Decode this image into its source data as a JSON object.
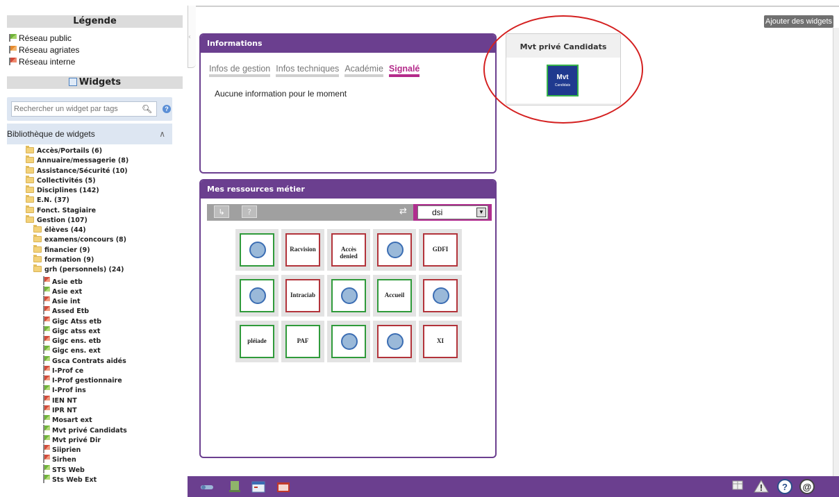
{
  "sidebar": {
    "legend_title": "Légende",
    "legend": [
      {
        "label": "Réseau public",
        "color": "green"
      },
      {
        "label": "Réseau agriates",
        "color": "orange"
      },
      {
        "label": "Réseau interne",
        "color": "red"
      }
    ],
    "widgets_title": "Widgets",
    "search_placeholder": "Rechercher un widget par tags",
    "library_title": "Bibliothèque de widgets",
    "tree": [
      {
        "label": "Accès/Portails (6)",
        "type": "folder",
        "level": 0
      },
      {
        "label": "Annuaire/messagerie (8)",
        "type": "folder",
        "level": 0
      },
      {
        "label": "Assistance/Sécurité (10)",
        "type": "folder",
        "level": 0
      },
      {
        "label": "Collectivités (5)",
        "type": "folder",
        "level": 0
      },
      {
        "label": "Disciplines (142)",
        "type": "folder",
        "level": 0
      },
      {
        "label": "E.N. (37)",
        "type": "folder",
        "level": 0
      },
      {
        "label": "Fonct. Stagiaire",
        "type": "folder",
        "level": 0
      },
      {
        "label": "Gestion (107)",
        "type": "folder",
        "level": 0
      },
      {
        "label": "élèves (44)",
        "type": "folder",
        "level": 1
      },
      {
        "label": "examens/concours (8)",
        "type": "folder",
        "level": 1
      },
      {
        "label": "financier (9)",
        "type": "folder",
        "level": 1
      },
      {
        "label": "formation (9)",
        "type": "folder",
        "level": 1
      },
      {
        "label": "grh (personnels) (24)",
        "type": "folder",
        "level": 1
      },
      {
        "label": "Asie etb",
        "type": "leaf",
        "flag": "red"
      },
      {
        "label": "Asie ext",
        "type": "leaf",
        "flag": "green"
      },
      {
        "label": "Asie int",
        "type": "leaf",
        "flag": "red"
      },
      {
        "label": "Assed Etb",
        "type": "leaf",
        "flag": "red"
      },
      {
        "label": "Gigc Atss etb",
        "type": "leaf",
        "flag": "red"
      },
      {
        "label": "Gigc atss ext",
        "type": "leaf",
        "flag": "green"
      },
      {
        "label": "Gigc ens. etb",
        "type": "leaf",
        "flag": "red"
      },
      {
        "label": "Gigc ens. ext",
        "type": "leaf",
        "flag": "green"
      },
      {
        "label": "Gsca Contrats aidés",
        "type": "leaf",
        "flag": "green"
      },
      {
        "label": "I-Prof ce",
        "type": "leaf",
        "flag": "red"
      },
      {
        "label": "I-Prof gestionnaire",
        "type": "leaf",
        "flag": "red"
      },
      {
        "label": "I-Prof ins",
        "type": "leaf",
        "flag": "green"
      },
      {
        "label": "IEN NT",
        "type": "leaf",
        "flag": "red"
      },
      {
        "label": "IPR NT",
        "type": "leaf",
        "flag": "red"
      },
      {
        "label": "Mosart ext",
        "type": "leaf",
        "flag": "green"
      },
      {
        "label": "Mvt privé Candidats",
        "type": "leaf",
        "flag": "green"
      },
      {
        "label": "Mvt privé Dir",
        "type": "leaf",
        "flag": "green"
      },
      {
        "label": "Siiprien",
        "type": "leaf",
        "flag": "red"
      },
      {
        "label": "Sirhen",
        "type": "leaf",
        "flag": "red"
      },
      {
        "label": "STS Web",
        "type": "leaf",
        "flag": "green"
      },
      {
        "label": "Sts Web Ext",
        "type": "leaf",
        "flag": "green"
      }
    ]
  },
  "main": {
    "add_widgets_label": "Ajouter des widgets",
    "info_panel": {
      "title": "Informations",
      "tabs": [
        "Infos de gestion",
        "Infos techniques",
        "Académie",
        "Signalé"
      ],
      "active_tab": "Signalé",
      "empty_message": "Aucune information pour le moment"
    },
    "resources_panel": {
      "title": "Mes ressources métier",
      "select_value": "dsi",
      "tiles": [
        {
          "name": "eduscol",
          "label": "",
          "border": "g"
        },
        {
          "name": "racvision",
          "label": "Racvision",
          "border": "r"
        },
        {
          "name": "accueil-denied",
          "label": "Accès denied",
          "border": "r"
        },
        {
          "name": "f-logo",
          "label": "",
          "border": "r"
        },
        {
          "name": "gdfi",
          "label": "GDFI",
          "border": "r"
        },
        {
          "name": "gnome",
          "label": "",
          "border": "g"
        },
        {
          "name": "intraciab",
          "label": "Intraciab",
          "border": "r"
        },
        {
          "name": "e-diff",
          "label": "",
          "border": "g"
        },
        {
          "name": "accueil",
          "label": "Accueil",
          "border": "g"
        },
        {
          "name": "keys",
          "label": "",
          "border": "r"
        },
        {
          "name": "pleiade",
          "label": "pléiade",
          "border": "g"
        },
        {
          "name": "paf",
          "label": "PAF",
          "border": "g"
        },
        {
          "name": "chat",
          "label": "",
          "border": "g"
        },
        {
          "name": "eduscol-2",
          "label": "",
          "border": "r"
        },
        {
          "name": "business-objects-xi",
          "label": "XI",
          "border": "r"
        }
      ]
    },
    "mvt_widget": {
      "title": "Mvt privé Candidats",
      "icon_text": "Mvt",
      "icon_sub": "Candidats"
    }
  },
  "colors": {
    "purple": "#6b3f8f",
    "magenta": "#b02e8f",
    "highlight_red": "#d42020"
  }
}
